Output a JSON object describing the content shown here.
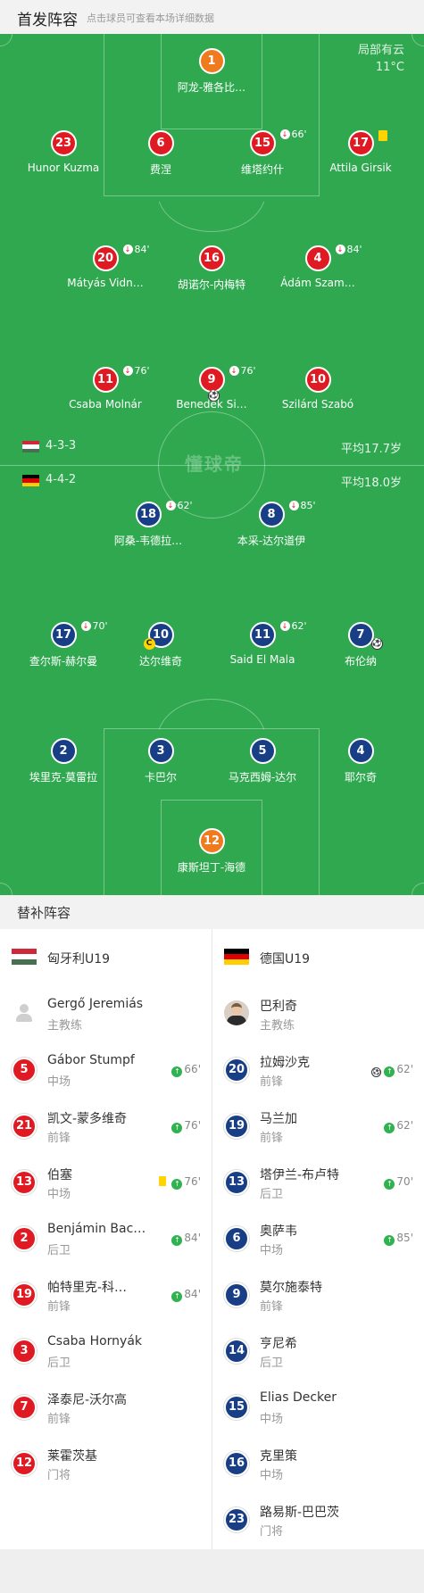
{
  "header": {
    "title": "首发阵容",
    "subtitle": "点击球员可查看本场详细数据"
  },
  "weather": {
    "condition": "局部有云",
    "temp": "11°C"
  },
  "watermark": "懂球帝",
  "home": {
    "flag_colors": [
      "#ce2939",
      "#ffffff",
      "#477050"
    ],
    "formation": "4-3-3",
    "avg_age": "平均17.7岁",
    "players": [
      {
        "num": "1",
        "name": "阿龙-雅各比…",
        "kind": "orange"
      },
      {
        "num": "23",
        "name": "Hunor Kuzma",
        "kind": "red"
      },
      {
        "num": "6",
        "name": "费涅",
        "kind": "red"
      },
      {
        "num": "15",
        "name": "维塔约什",
        "kind": "red",
        "sub": "66'"
      },
      {
        "num": "17",
        "name": "Attila Girsik",
        "kind": "red",
        "yellow": true
      },
      {
        "num": "20",
        "name": "Mátyás Vidn…",
        "kind": "red",
        "sub": "84'"
      },
      {
        "num": "16",
        "name": "胡诺尔-内梅特",
        "kind": "red"
      },
      {
        "num": "4",
        "name": "Ádám Szam…",
        "kind": "red",
        "sub": "84'"
      },
      {
        "num": "11",
        "name": "Csaba Molnár",
        "kind": "red",
        "sub": "76'"
      },
      {
        "num": "9",
        "name": "Benedek Si…",
        "kind": "red",
        "sub": "76'",
        "goal": true
      },
      {
        "num": "10",
        "name": "Szilárd Szabó",
        "kind": "red"
      }
    ]
  },
  "away": {
    "flag_colors": [
      "#000000",
      "#dd0000",
      "#ffce00"
    ],
    "formation": "4-4-2",
    "avg_age": "平均18.0岁",
    "players": [
      {
        "num": "18",
        "name": "阿桑-韦德拉…",
        "kind": "blue",
        "sub": "62'"
      },
      {
        "num": "8",
        "name": "本采-达尔道伊",
        "kind": "blue",
        "sub": "85'"
      },
      {
        "num": "17",
        "name": "查尔斯-赫尔曼",
        "kind": "blue",
        "sub": "70'"
      },
      {
        "num": "10",
        "name": "达尔维奇",
        "kind": "blue",
        "captain": "C"
      },
      {
        "num": "11",
        "name": "Said El Mala",
        "kind": "blue",
        "sub": "62'"
      },
      {
        "num": "7",
        "name": "布伦纳",
        "kind": "blue",
        "goal": true
      },
      {
        "num": "2",
        "name": "埃里克-莫雷拉",
        "kind": "blue"
      },
      {
        "num": "3",
        "name": "卡巴尔",
        "kind": "blue"
      },
      {
        "num": "5",
        "name": "马克西姆-达尔",
        "kind": "blue"
      },
      {
        "num": "4",
        "name": "耶尔奇",
        "kind": "blue"
      },
      {
        "num": "12",
        "name": "康斯坦丁-海德",
        "kind": "orange"
      }
    ]
  },
  "subs": {
    "header": "替补阵容",
    "home": {
      "team": "匈牙利U19",
      "coach": {
        "name": "Gergő Jeremiás",
        "role": "主教练"
      },
      "rows": [
        {
          "num": "5",
          "name": "Gábor Stumpf",
          "pos": "中场",
          "minute": "66'"
        },
        {
          "num": "21",
          "name": "凯文-蒙多维奇",
          "pos": "前锋",
          "minute": "76'"
        },
        {
          "num": "13",
          "name": "伯塞",
          "pos": "中场",
          "minute": "76'",
          "yellow": true
        },
        {
          "num": "2",
          "name": "Benjámin Bac…",
          "pos": "后卫",
          "minute": "84'"
        },
        {
          "num": "19",
          "name": "帕特里克-科…",
          "pos": "前锋",
          "minute": "84'"
        },
        {
          "num": "3",
          "name": "Csaba Hornyák",
          "pos": "后卫"
        },
        {
          "num": "7",
          "name": "泽泰尼-沃尔高",
          "pos": "前锋"
        },
        {
          "num": "12",
          "name": "莱霍茨基",
          "pos": "门将"
        }
      ]
    },
    "away": {
      "team": "德国U19",
      "coach": {
        "name": "巴利奇",
        "role": "主教练"
      },
      "rows": [
        {
          "num": "20",
          "name": "拉姆沙克",
          "pos": "前锋",
          "minute": "62'",
          "goal": true
        },
        {
          "num": "19",
          "name": "马兰加",
          "pos": "前锋",
          "minute": "62'"
        },
        {
          "num": "13",
          "name": "塔伊兰-布卢特",
          "pos": "后卫",
          "minute": "70'"
        },
        {
          "num": "6",
          "name": "奥萨韦",
          "pos": "中场",
          "minute": "85'"
        },
        {
          "num": "9",
          "name": "莫尔施泰特",
          "pos": "前锋"
        },
        {
          "num": "14",
          "name": "亨尼希",
          "pos": "后卫"
        },
        {
          "num": "15",
          "name": "Elias Decker",
          "pos": "中场"
        },
        {
          "num": "16",
          "name": "克里策",
          "pos": "中场"
        },
        {
          "num": "23",
          "name": "路易斯-巴巴茨",
          "pos": "门将"
        }
      ]
    }
  }
}
